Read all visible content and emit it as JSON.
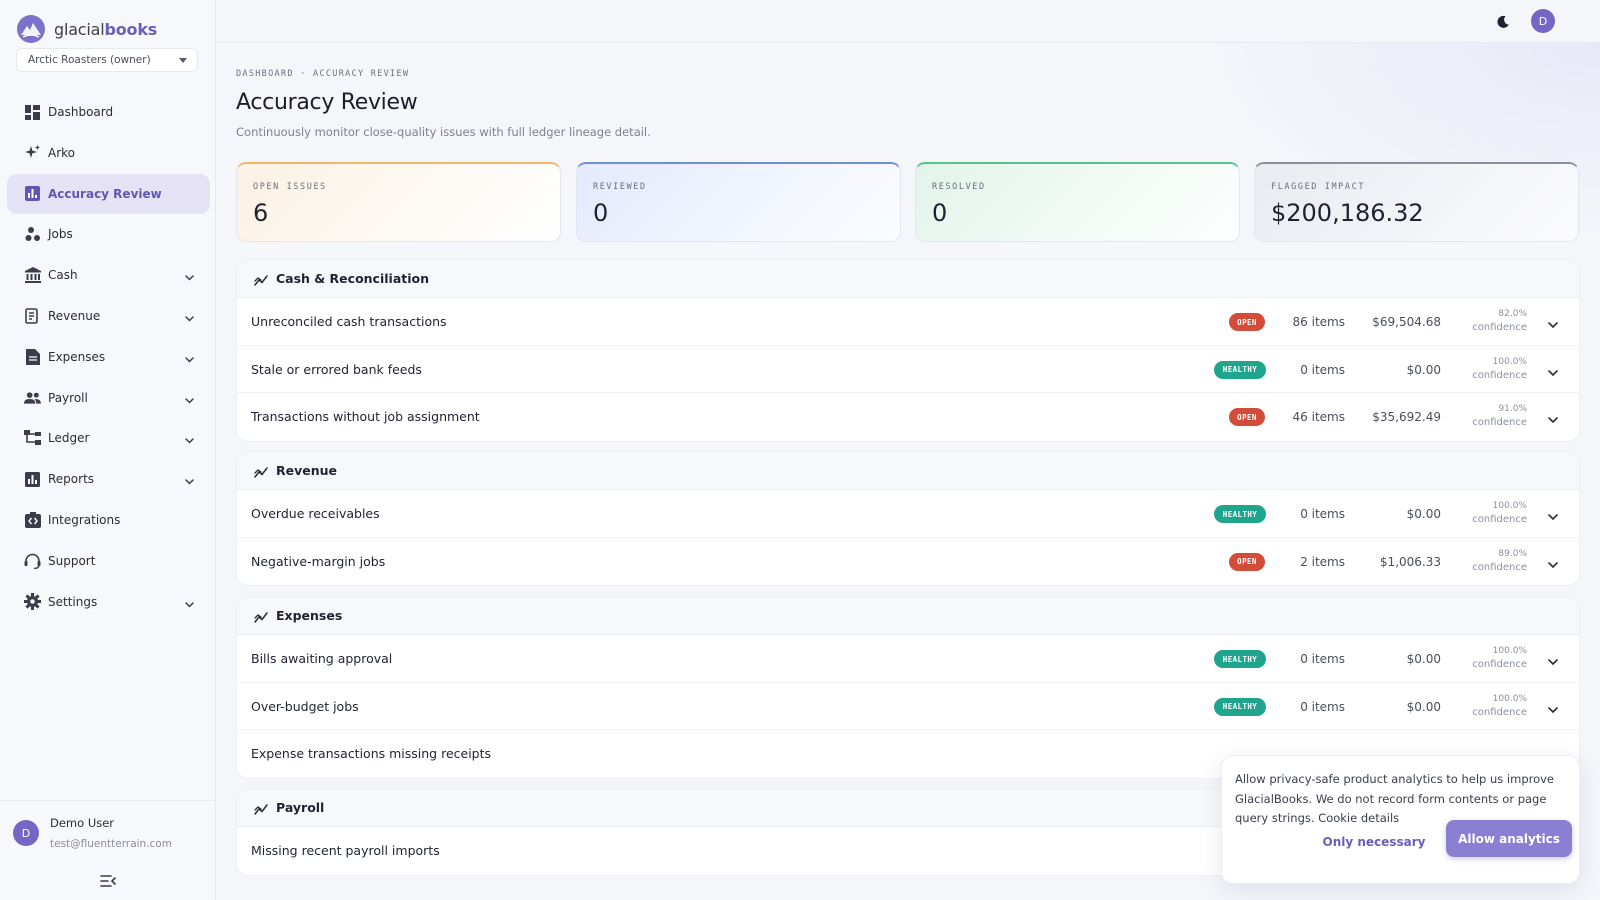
{
  "brand": {
    "name_part1": "glacial",
    "name_part2": "books"
  },
  "org_select": {
    "value": "Arctic Roasters (owner)"
  },
  "nav": [
    {
      "label": "Dashboard",
      "icon": "dashboard-icon",
      "expandable": false
    },
    {
      "label": "Arko",
      "icon": "sparkle-icon",
      "expandable": false
    },
    {
      "label": "Accuracy Review",
      "icon": "bar-chart-icon",
      "expandable": false,
      "active": true
    },
    {
      "label": "Jobs",
      "icon": "jobs-icon",
      "expandable": false
    },
    {
      "label": "Cash",
      "icon": "bank-icon",
      "expandable": true
    },
    {
      "label": "Revenue",
      "icon": "receipt-icon",
      "expandable": true
    },
    {
      "label": "Expenses",
      "icon": "document-icon",
      "expandable": true
    },
    {
      "label": "Payroll",
      "icon": "people-icon",
      "expandable": true
    },
    {
      "label": "Ledger",
      "icon": "tree-icon",
      "expandable": true
    },
    {
      "label": "Reports",
      "icon": "report-icon",
      "expandable": true
    },
    {
      "label": "Integrations",
      "icon": "integrations-icon",
      "expandable": false
    },
    {
      "label": "Support",
      "icon": "headset-icon",
      "expandable": false
    },
    {
      "label": "Settings",
      "icon": "gear-icon",
      "expandable": true
    }
  ],
  "user": {
    "initial": "D",
    "name": "Demo User",
    "email": "test@fluentterrain.com"
  },
  "topbar": {
    "avatar_initial": "D"
  },
  "page": {
    "breadcrumb_root": "DASHBOARD",
    "breadcrumb_sep": "·",
    "breadcrumb_current": "ACCURACY REVIEW",
    "title": "Accuracy Review",
    "subtitle": "Continuously monitor close-quality issues with full ledger lineage detail."
  },
  "stats": [
    {
      "label": "OPEN ISSUES",
      "value": "6"
    },
    {
      "label": "REVIEWED",
      "value": "0"
    },
    {
      "label": "RESOLVED",
      "value": "0"
    },
    {
      "label": "FLAGGED IMPACT",
      "value": "$200,186.32"
    }
  ],
  "sections": [
    {
      "title": "Cash & Reconciliation",
      "rows": [
        {
          "title": "Unreconciled cash transactions",
          "status": "OPEN",
          "items": "86 items",
          "amount": "$69,504.68",
          "confidence": "82.0%",
          "confidence_label": "confidence"
        },
        {
          "title": "Stale or errored bank feeds",
          "status": "HEALTHY",
          "items": "0 items",
          "amount": "$0.00",
          "confidence": "100.0%",
          "confidence_label": "confidence"
        },
        {
          "title": "Transactions without job assignment",
          "status": "OPEN",
          "items": "46 items",
          "amount": "$35,692.49",
          "confidence": "91.0%",
          "confidence_label": "confidence"
        }
      ]
    },
    {
      "title": "Revenue",
      "rows": [
        {
          "title": "Overdue receivables",
          "status": "HEALTHY",
          "items": "0 items",
          "amount": "$0.00",
          "confidence": "100.0%",
          "confidence_label": "confidence"
        },
        {
          "title": "Negative-margin jobs",
          "status": "OPEN",
          "items": "2 items",
          "amount": "$1,006.33",
          "confidence": "89.0%",
          "confidence_label": "confidence"
        }
      ]
    },
    {
      "title": "Expenses",
      "rows": [
        {
          "title": "Bills awaiting approval",
          "status": "HEALTHY",
          "items": "0 items",
          "amount": "$0.00",
          "confidence": "100.0%",
          "confidence_label": "confidence"
        },
        {
          "title": "Over-budget jobs",
          "status": "HEALTHY",
          "items": "0 items",
          "amount": "$0.00",
          "confidence": "100.0%",
          "confidence_label": "confidence"
        },
        {
          "title": "Expense transactions missing receipts"
        }
      ]
    },
    {
      "title": "Payroll",
      "rows": [
        {
          "title": "Missing recent payroll imports"
        }
      ]
    }
  ],
  "cookie": {
    "text": "Allow privacy-safe product analytics to help us improve GlacialBooks. We do not record form contents or page query strings.",
    "link": "Cookie details",
    "necessary_label": "Only necessary",
    "allow_label": "Allow analytics"
  },
  "colors": {
    "accent": "#6256b3",
    "open": "#d24c3a",
    "healthy": "#1fa58e"
  }
}
